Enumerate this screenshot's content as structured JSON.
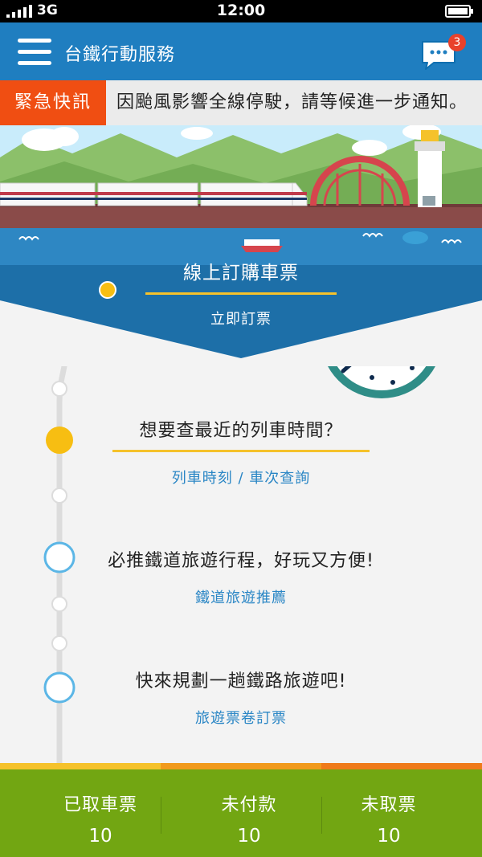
{
  "status_bar": {
    "network": "3G",
    "time": "12:00"
  },
  "app_bar": {
    "title": "台鐵行動服務",
    "message_count": "3"
  },
  "alert": {
    "tag": "緊急快訊",
    "text": "因颱風影響全線停駛，請等候進一步通知。"
  },
  "hero": {
    "title": "線上訂購車票",
    "link": "立即訂票"
  },
  "sections": [
    {
      "question": "想要查最近的列車時間？",
      "link": "列車時刻 / 車次查詢"
    },
    {
      "question": "必推鐵道旅遊行程，好玩又方便!",
      "link": "鐵道旅遊推薦"
    },
    {
      "question": "快來規劃一趟鐵路旅遊吧!",
      "link": "旅遊票卷訂票"
    }
  ],
  "bottom": [
    {
      "label": "已取車票",
      "value": "10"
    },
    {
      "label": "未付款",
      "value": "10"
    },
    {
      "label": "未取票",
      "value": "10"
    }
  ],
  "colors": {
    "primary": "#1f7ec0",
    "alert": "#f04e12",
    "accent": "#f5c22b",
    "bottom": "#72a612",
    "link": "#2a86c5"
  }
}
